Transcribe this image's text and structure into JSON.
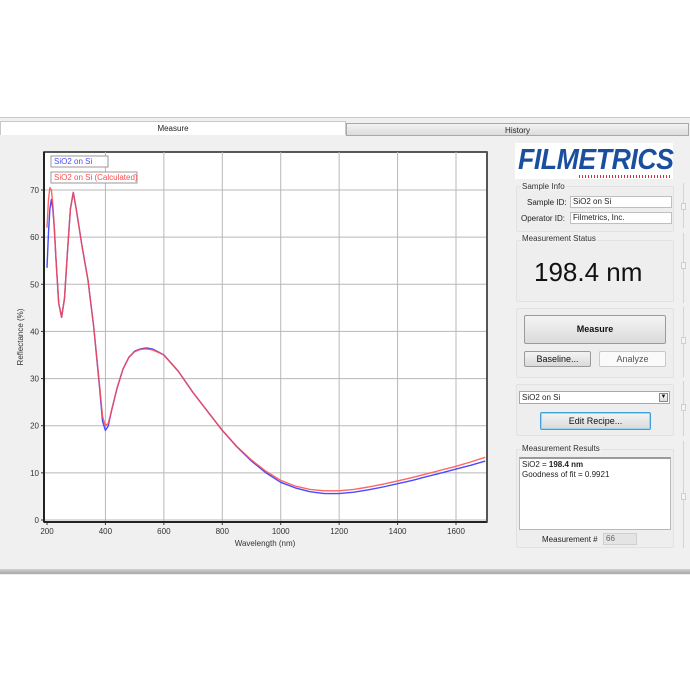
{
  "tabs": [
    {
      "label": "Measure",
      "active": true
    },
    {
      "label": "History",
      "active": false
    }
  ],
  "brand": {
    "logo_text": "FILMETRICS",
    "logo_color": "#1a4fa0",
    "accent_red": "#d0303a"
  },
  "sample_info": {
    "title": "Sample Info",
    "sample_id_label": "Sample ID:",
    "sample_id_value": "SiO2 on Si",
    "operator_id_label": "Operator ID:",
    "operator_id_value": "Filmetrics, Inc."
  },
  "measurement_status": {
    "title": "Measurement Status",
    "value": "198.4 nm"
  },
  "actions": {
    "measure_label": "Measure",
    "baseline_label": "Baseline...",
    "analyze_label": "Analyze"
  },
  "recipe": {
    "selected": "SiO2 on Si",
    "edit_label": "Edit Recipe..."
  },
  "results": {
    "title": "Measurement Results",
    "line1_prefix": "SiO2 = ",
    "line1_value": "198.4 nm",
    "line2": "Goodness of fit = 0.9921",
    "measurement_number_label": "Measurement #",
    "measurement_number": "66"
  },
  "chart_data": {
    "type": "line",
    "title": "",
    "xlabel": "Wavelength (nm)",
    "ylabel": "Reflectance (%)",
    "xlim": [
      200,
      1700
    ],
    "ylim": [
      0,
      78
    ],
    "xticks": [
      200,
      400,
      600,
      800,
      1000,
      1200,
      1400,
      1600
    ],
    "yticks": [
      0,
      10,
      20,
      30,
      40,
      50,
      60,
      70
    ],
    "grid": true,
    "legend_position": "top-left",
    "series": [
      {
        "name": "SiO2 on Si",
        "color": "#4a4aff",
        "x": [
          200,
          205,
          210,
          215,
          220,
          225,
          230,
          240,
          250,
          260,
          270,
          280,
          290,
          300,
          320,
          340,
          360,
          380,
          390,
          400,
          410,
          420,
          440,
          460,
          480,
          500,
          520,
          540,
          560,
          580,
          600,
          650,
          700,
          750,
          800,
          850,
          900,
          950,
          1000,
          1050,
          1100,
          1150,
          1200,
          1250,
          1300,
          1350,
          1400,
          1450,
          1500,
          1550,
          1600,
          1650,
          1700
        ],
        "y": [
          53.5,
          61,
          66,
          68,
          66,
          62,
          56,
          46,
          43,
          47,
          57,
          66,
          69.5,
          66,
          58,
          51,
          41,
          28,
          21,
          19,
          20,
          23,
          28,
          32,
          34.5,
          35.8,
          36.3,
          36.5,
          36.3,
          35.7,
          35,
          31.5,
          27,
          23,
          19,
          15.5,
          12.5,
          10,
          8,
          6.8,
          6,
          5.6,
          5.6,
          5.9,
          6.4,
          7,
          7.7,
          8.4,
          9.2,
          10,
          10.8,
          11.6,
          12.5
        ]
      },
      {
        "name": "SiO2 on Si (Calculated)",
        "color": "#ff4a4a",
        "x": [
          200,
          205,
          210,
          215,
          220,
          225,
          230,
          240,
          250,
          260,
          270,
          280,
          290,
          300,
          320,
          340,
          360,
          380,
          390,
          400,
          410,
          420,
          440,
          460,
          480,
          500,
          520,
          540,
          560,
          580,
          600,
          650,
          700,
          750,
          800,
          850,
          900,
          950,
          1000,
          1050,
          1100,
          1150,
          1200,
          1250,
          1300,
          1350,
          1400,
          1450,
          1500,
          1550,
          1600,
          1650,
          1700
        ],
        "y": [
          62,
          68,
          70.5,
          70,
          67,
          62,
          56,
          46,
          43,
          47,
          57,
          66,
          69.5,
          66,
          58,
          51,
          41,
          28.5,
          22,
          20,
          20.5,
          23,
          28,
          32,
          34.5,
          35.7,
          36.2,
          36.3,
          36.1,
          35.6,
          35,
          31.5,
          27,
          23,
          19,
          15.6,
          12.7,
          10.3,
          8.4,
          7.2,
          6.5,
          6.2,
          6.2,
          6.5,
          7,
          7.6,
          8.3,
          9,
          9.8,
          10.6,
          11.4,
          12.3,
          13.3
        ]
      }
    ]
  }
}
